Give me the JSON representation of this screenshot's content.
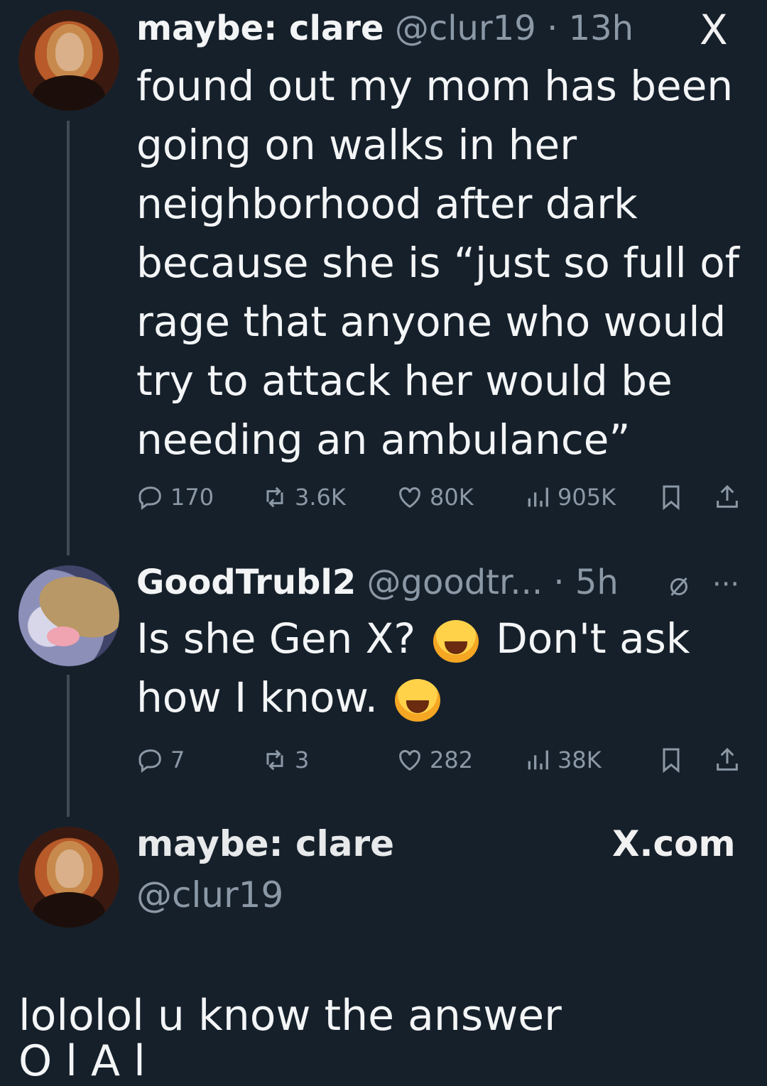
{
  "tweet1": {
    "name": "maybe: clare",
    "handle": "@clur19",
    "time": "· 13h",
    "body": "found out my mom has been going on walks in her neighborhood after dark because she is “just so full of rage that anyone who would try to attack her would be needing an ambulance”",
    "replies": "170",
    "reposts": "3.6K",
    "likes": "80K",
    "views": "905K"
  },
  "tweet2": {
    "name": "GoodTrubl2",
    "handle": "@goodtr...",
    "time": "· 5h",
    "text_a": "Is she Gen X?",
    "text_b": "Don't ask",
    "text_c": "how I know.",
    "replies": "7",
    "reposts": "3",
    "likes": "282",
    "views": "38K"
  },
  "footer": {
    "name": "maybe: clare",
    "handle": "@clur19",
    "brand": "X.com"
  },
  "caption": "lololol u know the answer",
  "caption_cut": "O   l   A   l",
  "icons": {
    "x_logo": "X"
  },
  "colors": {
    "background": "#16202b",
    "text": "#f3f5f6",
    "muted": "#8b98a5"
  }
}
